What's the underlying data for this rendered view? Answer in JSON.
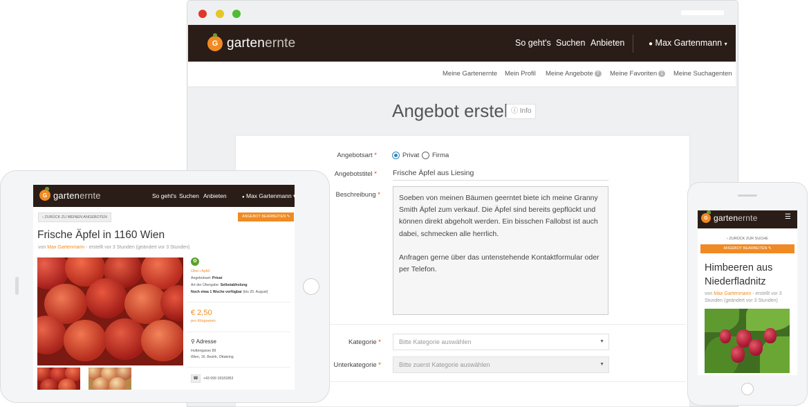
{
  "desktop": {
    "logo_text_a": "garten",
    "logo_text_b": "ernte",
    "logo_glyph": "G",
    "nav": [
      "So geht's",
      "Suchen",
      "Anbieten"
    ],
    "user": "Max Gartenmann",
    "user_caret": "▾",
    "subnav": [
      {
        "label": "Meine Gartenernte",
        "badge": ""
      },
      {
        "label": "Mein Profil",
        "badge": ""
      },
      {
        "label": "Meine Angebote",
        "badge": "7"
      },
      {
        "label": "Meine Favoriten",
        "badge": "1"
      },
      {
        "label": "Meine Suchagenten",
        "badge": ""
      }
    ],
    "page_title": "Angebot erstellen",
    "info_label": "Info",
    "form": {
      "offer_type_label": "Angebotsart",
      "offer_type_options": [
        "Privat",
        "Firma"
      ],
      "offer_type_selected": "Privat",
      "title_label": "Angebotstitel",
      "title_value": "Frische Äpfel aus Liesing",
      "desc_label": "Beschreibung",
      "desc_value": "Soeben von meinen Bäumen geerntet biete ich meine Granny Smith Äpfel zum verkauf. Die Äpfel sind bereits gepflückt und können direkt abgeholt werden. Ein bisschen Fallobst ist auch dabei, schmecken alle herrlich.\n\nAnfragen gerne über das untenstehende Kontaktformular oder per Telefon.",
      "category_label": "Kategorie",
      "category_placeholder": "Bitte Kategorie auswählen",
      "subcategory_label": "Unterkategorie",
      "subcategory_placeholder": "Bitte zuerst Kategorie auswählen",
      "required_mark": "*"
    }
  },
  "tablet": {
    "nav": [
      "So geht's",
      "Suchen",
      "Anbieten"
    ],
    "user": "Max Gartenmann",
    "back_button": "‹ ZURÜCK ZU MEINEN ANGEBOTEN",
    "edit_button": "ANGEBOT BEARBEITEN ✎",
    "title": "Frische Äpfel in 1160 Wien",
    "by_prefix": "von",
    "by_user": "Max Gartenmann",
    "by_suffix": "- erstellt vor 3 Stunden (geändert vor 3 Stunden)",
    "crumb_a": "Obst",
    "crumb_b": "Apfel",
    "offer_type_key": "Angebotsart:",
    "offer_type_val": "Privat",
    "handover_key": "Art der Übergabe:",
    "handover_val": "Selbstabholung",
    "availability": "Noch etwa 1 Woche verfügbar",
    "availability_date": "(bis 20. August)",
    "price": "€ 2,50",
    "price_unit": "pro Kilogramm",
    "address_label": "Adresse",
    "address_line1": "Huttengasse 89",
    "address_line2": "Wien, 16. Bezirk, Ottakring",
    "phone": "+43 699 18181853"
  },
  "phone": {
    "back_button": "‹ ZURÜCK ZUR SUCHE",
    "edit_button": "ANGEBOT BEARBEITEN ✎",
    "title": "Himbeeren aus Niederfladnitz",
    "by_prefix": "von",
    "by_user": "Max Gartenmann",
    "by_suffix": "- erstellt vor 3 Stunden (geändert vor 3 Stunden)"
  },
  "colors": {
    "brand_orange": "#f08a24",
    "nav_dark": "#2a1d17",
    "radio_blue": "#2e86c1",
    "required_red": "#e0431d"
  },
  "icons": [
    "close-dot",
    "minimize-dot",
    "maximize-dot",
    "user-icon",
    "info-icon",
    "leaf-icon",
    "map-pin-icon",
    "phone-icon",
    "menu-icon",
    "pencil-icon"
  ]
}
